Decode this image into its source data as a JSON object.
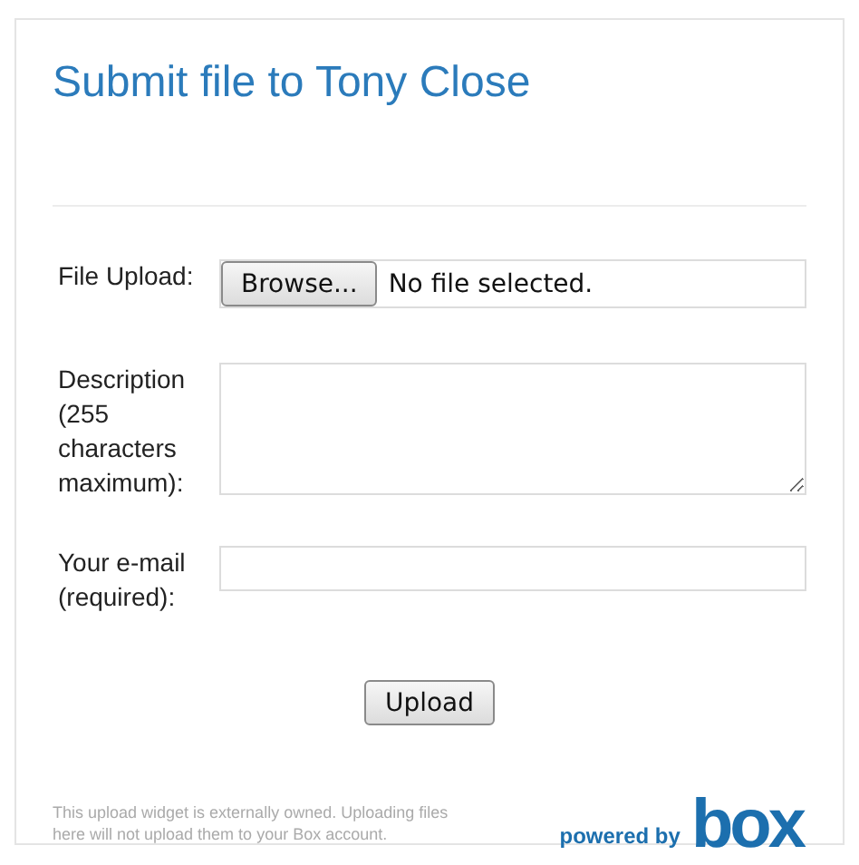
{
  "title": "Submit file to Tony Close",
  "file_upload": {
    "label": "File Upload:",
    "button": "Browse...",
    "status": "No file selected."
  },
  "description": {
    "label": "Description (255 characters maximum):"
  },
  "email": {
    "label": "Your e-mail (required):"
  },
  "submit": "Upload",
  "footer": {
    "notice": "This upload widget is externally owned. Uploading files here will not upload them to your Box account.",
    "powered_by": "powered by",
    "logo": "box"
  }
}
